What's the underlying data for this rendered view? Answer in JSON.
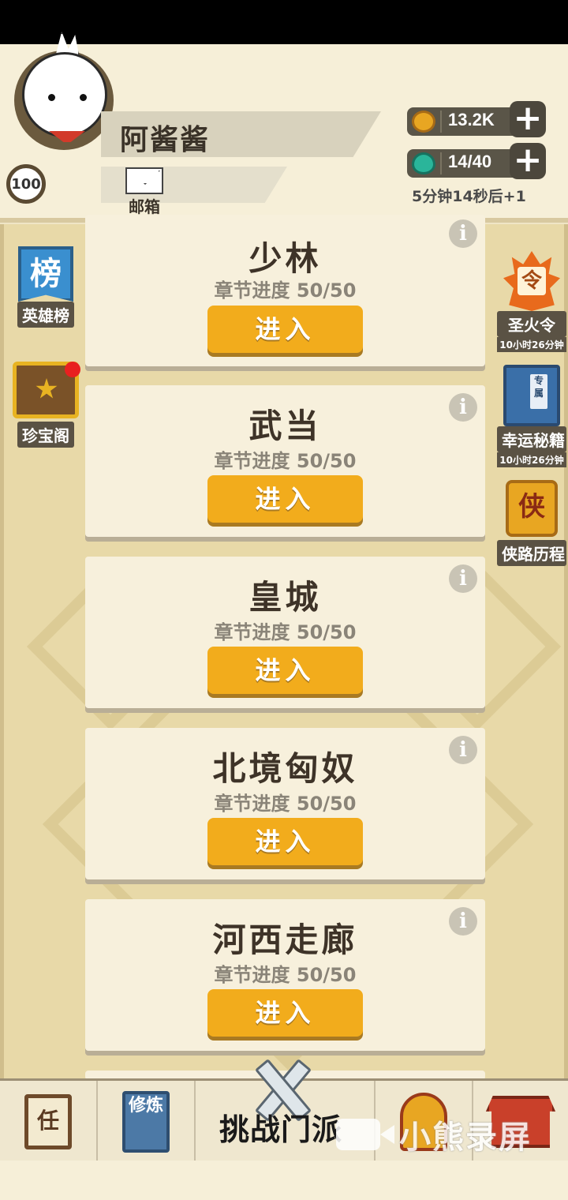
{
  "player": {
    "name": "阿酱酱",
    "level": "100",
    "mail_label": "邮箱"
  },
  "resources": {
    "coins": "13.2K",
    "energy": "14/40",
    "regen_text": "5分钟14秒后+1",
    "plus": "+"
  },
  "left_sidebar": {
    "heroes": {
      "icon_text": "榜",
      "label": "英雄榜"
    },
    "treasure": {
      "label": "珍宝阁"
    }
  },
  "right_sidebar": {
    "holy_fire": {
      "icon_text": "令",
      "label": "圣火令",
      "timer": "10小时26分钟"
    },
    "secret_book": {
      "icon_text": "专属",
      "label": "幸运秘籍",
      "timer": "10小时26分钟"
    },
    "hero_path": {
      "icon_text": "侠",
      "label": "侠路历程"
    }
  },
  "sects": [
    {
      "name": "少林",
      "progress": "章节进度 50/50",
      "enter": "进入"
    },
    {
      "name": "武当",
      "progress": "章节进度 50/50",
      "enter": "进入"
    },
    {
      "name": "皇城",
      "progress": "章节进度 50/50",
      "enter": "进入"
    },
    {
      "name": "北境匈奴",
      "progress": "章节进度 50/50",
      "enter": "进入"
    },
    {
      "name": "河西走廊",
      "progress": "章节进度 50/50",
      "enter": "进入"
    }
  ],
  "info_glyph": "i",
  "bottom_nav": {
    "task_icon_text": "任",
    "train_icon_text": "修炼",
    "challenge_label": "挑战门派",
    "watermark": "小熊录屏"
  },
  "colors": {
    "accent_button": "#f2ac1c",
    "card_bg": "#f7f0dc",
    "page_bg": "#e8d9a8"
  }
}
